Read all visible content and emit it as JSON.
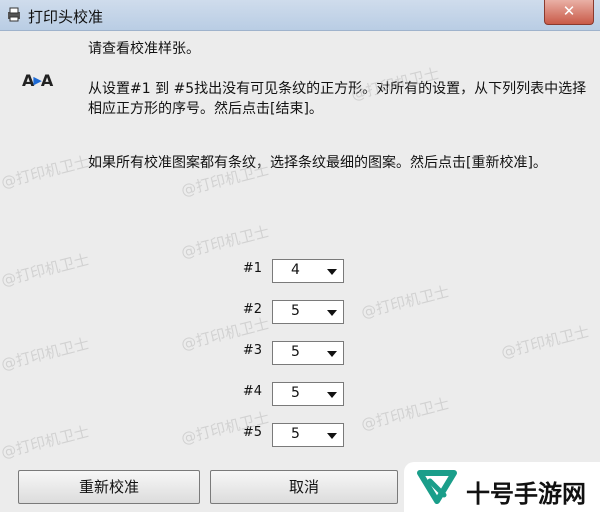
{
  "window": {
    "title": "打印头校准",
    "close_symbol": "✕"
  },
  "dialog": {
    "heading": "请查看校准样张。",
    "instruction": "从设置#1 到 #5找出没有可见条纹的正方形。对所有的设置，从下列列表中选择相应正方形的序号。然后点击[结束]。",
    "note": "如果所有校准图案都有条纹，选择条纹最细的图案。然后点击[重新校准]。",
    "icon_text": "A▸A",
    "settings": [
      {
        "label": "#1",
        "value": "4"
      },
      {
        "label": "#2",
        "value": "5"
      },
      {
        "label": "#3",
        "value": "5"
      },
      {
        "label": "#4",
        "value": "5"
      },
      {
        "label": "#5",
        "value": "5"
      }
    ],
    "buttons": {
      "recalibrate": "重新校准",
      "cancel": "取消"
    }
  },
  "watermark": {
    "text": "@打印机卫士"
  },
  "brand": {
    "name": "十号手游网",
    "color": "#1a9e8a"
  }
}
